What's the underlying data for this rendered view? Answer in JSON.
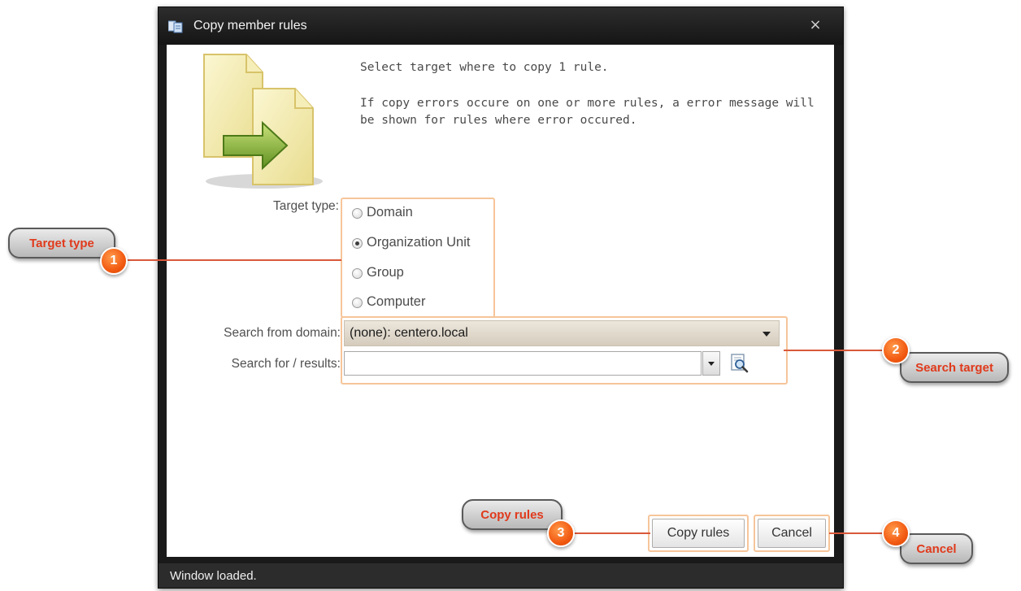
{
  "window": {
    "title": "Copy member rules",
    "close_label": "×",
    "status": "Window loaded."
  },
  "intro": {
    "line1": "Select target where to copy 1 rule.",
    "line2": "If copy errors occure on one or more rules, a error message will be shown for rules where error occured."
  },
  "target_type": {
    "label": "Target type:",
    "options": [
      {
        "label": "Domain",
        "checked": false
      },
      {
        "label": "Organization Unit",
        "checked": true
      },
      {
        "label": "Group",
        "checked": false
      },
      {
        "label": "Computer",
        "checked": false
      }
    ]
  },
  "search": {
    "domain_label": "Search from domain:",
    "domain_value": "(none): centero.local",
    "for_label": "Search for / results:",
    "for_value": "",
    "button_icon": "magnifier-document-icon"
  },
  "buttons": {
    "copy": "Copy rules",
    "cancel": "Cancel"
  },
  "callouts": [
    {
      "number": "1",
      "label": "Target type"
    },
    {
      "number": "2",
      "label": "Search target"
    },
    {
      "number": "3",
      "label": "Copy rules"
    },
    {
      "number": "4",
      "label": "Cancel"
    }
  ],
  "colors": {
    "highlight_border": "#f6c59a",
    "callout_text": "#e03a1c",
    "badge": "#f25a12",
    "window_chrome": "#1a1a1a"
  }
}
